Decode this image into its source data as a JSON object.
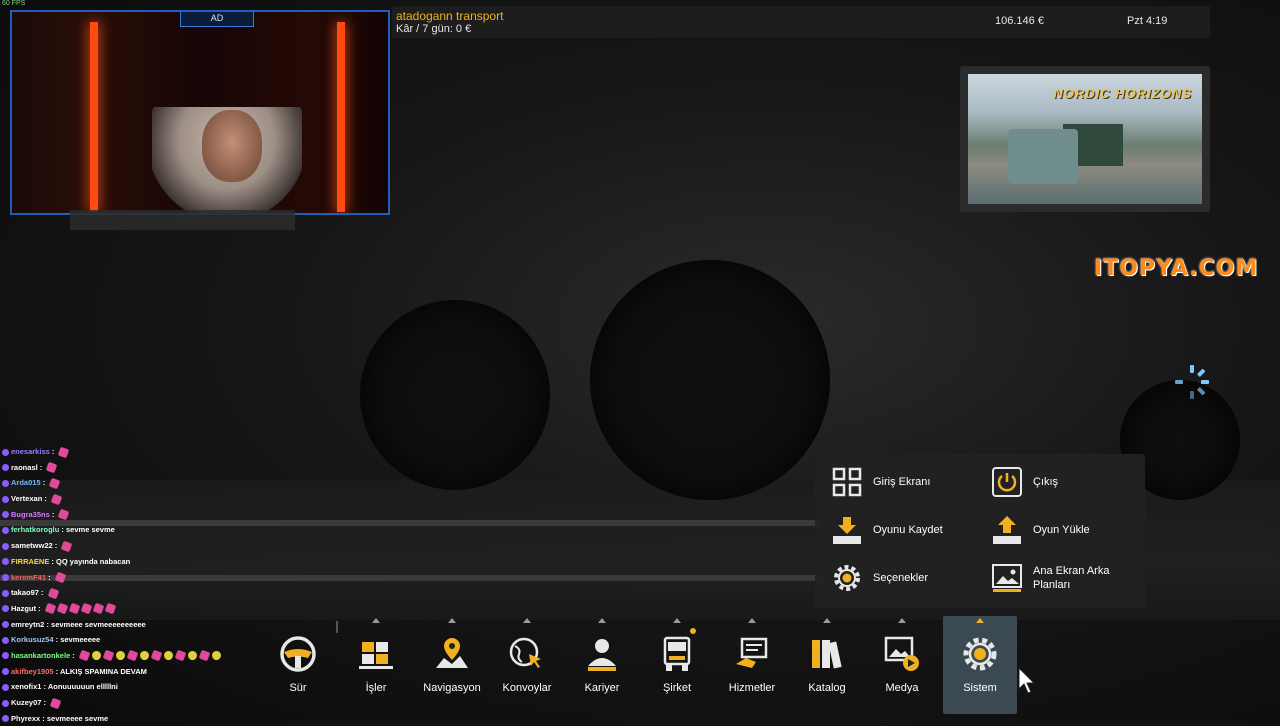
{
  "overlay": {
    "fps": "60 FPS"
  },
  "webcam": {
    "logo": "AD"
  },
  "topbar": {
    "company": "atadogann transport",
    "profit": "Kâr / 7 gün: 0 €",
    "money": "106.146 €",
    "time": "Pzt 4:19"
  },
  "promo": {
    "title": "NORDIC HORIZONS"
  },
  "sponsor": {
    "text": "ITOPYA.COM"
  },
  "chat": [
    {
      "user": "enesarkiss",
      "color": "#9a7cff",
      "msg": "",
      "emotes": 1
    },
    {
      "user": "raonasl",
      "color": "#ffffff",
      "msg": "",
      "emotes": 1
    },
    {
      "user": "Arda015",
      "color": "#6fb7ff",
      "msg": "",
      "emotes": 1
    },
    {
      "user": "Vertexan",
      "color": "#ffffff",
      "msg": "",
      "emotes": 1
    },
    {
      "user": "Bugra35ns",
      "color": "#d47cff",
      "msg": "",
      "emotes": 1
    },
    {
      "user": "ferhatkoroglu",
      "color": "#7cffc4",
      "msg": "sevme sevme",
      "emotes": 0
    },
    {
      "user": "sametww22",
      "color": "#ffffff",
      "msg": "",
      "emotes": 1
    },
    {
      "user": "FIRRAENE",
      "color": "#ffd24a",
      "msg": "QQ yayında nabacan",
      "emotes": 0
    },
    {
      "user": "keremF41",
      "color": "#ff5a5a",
      "msg": "",
      "emotes": 1
    },
    {
      "user": "takao97",
      "color": "#ffffff",
      "msg": "",
      "emotes": 1
    },
    {
      "user": "Hazgut",
      "color": "#ffffff",
      "msg": "",
      "emotes": 6
    },
    {
      "user": "emreytn2",
      "color": "#ffffff",
      "msg": "sevmeee sevmeeeeeeeeee",
      "emotes": 0
    },
    {
      "user": "Korkusuz54",
      "color": "#a0c8ff",
      "msg": "sevmeeeee",
      "emotes": 0
    },
    {
      "user": "hasankartonkele",
      "color": "#7cff7c",
      "msg": "",
      "emotes": 12
    },
    {
      "user": "akifbey1905",
      "color": "#ff6a6a",
      "msg": "ALKIŞ SPAMINA DEVAM",
      "emotes": 0
    },
    {
      "user": "xenofix1",
      "color": "#ffffff",
      "msg": "Aonuuuuuun elllllni",
      "emotes": 0
    },
    {
      "user": "Kuzey07",
      "color": "#ffffff",
      "msg": "",
      "emotes": 1
    },
    {
      "user": "Phyrexx",
      "color": "#ffffff",
      "msg": "sevmeeee sevme",
      "emotes": 0
    }
  ],
  "system_menu": {
    "items": [
      {
        "label": "Giriş Ekranı",
        "icon": "grid-icon"
      },
      {
        "label": "Çıkış",
        "icon": "power-icon"
      },
      {
        "label": "Oyunu Kaydet",
        "icon": "save-icon"
      },
      {
        "label": "Oyun Yükle",
        "icon": "load-icon"
      },
      {
        "label": "Seçenekler",
        "icon": "gear-icon"
      },
      {
        "label": "Ana Ekran Arka Planları",
        "icon": "image-icon"
      }
    ]
  },
  "bottom_nav": {
    "items": [
      {
        "label": "Sür",
        "icon": "steering-wheel-icon"
      },
      {
        "label": "İşler",
        "icon": "cargo-icon"
      },
      {
        "label": "Navigasyon",
        "icon": "map-pin-icon"
      },
      {
        "label": "Konvoylar",
        "icon": "globe-cursor-icon"
      },
      {
        "label": "Kariyer",
        "icon": "person-icon"
      },
      {
        "label": "Şirket",
        "icon": "truck-front-icon"
      },
      {
        "label": "Hizmetler",
        "icon": "services-icon"
      },
      {
        "label": "Katalog",
        "icon": "books-icon"
      },
      {
        "label": "Medya",
        "icon": "media-icon"
      },
      {
        "label": "Sistem",
        "icon": "gear-icon"
      }
    ],
    "active": "Sistem"
  },
  "colors": {
    "accent": "#f0b020",
    "panel": "#222222",
    "active_tab": "#3b4a52"
  }
}
